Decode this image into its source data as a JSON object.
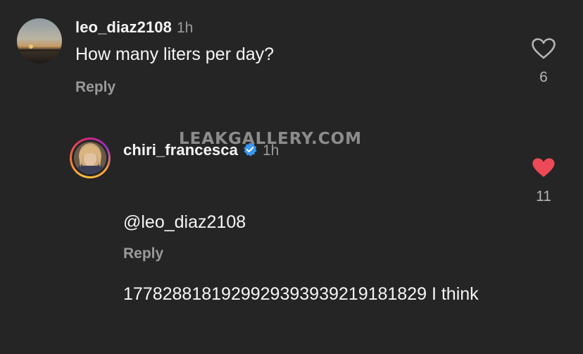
{
  "comments": [
    {
      "username": "leo_diaz2108",
      "time": "1h",
      "text": "How many liters per day?",
      "reply_label": "Reply",
      "likes": "6",
      "liked": false
    },
    {
      "username": "chiri_francesca",
      "time": "1h",
      "verified": true,
      "mention": "@leo_diaz2108",
      "text": "177828818192992939393921918182​9 I think",
      "reply_label": "Reply",
      "likes": "11",
      "liked": true
    }
  ],
  "watermark": "LEAKGALLERY.COM",
  "colors": {
    "background": "#252525",
    "like_active": "#ed4956",
    "verified": "#3897f0"
  },
  "icons": {
    "like_outline": "heart-outline-icon",
    "like_filled": "heart-filled-icon",
    "verified": "verified-badge-icon"
  }
}
